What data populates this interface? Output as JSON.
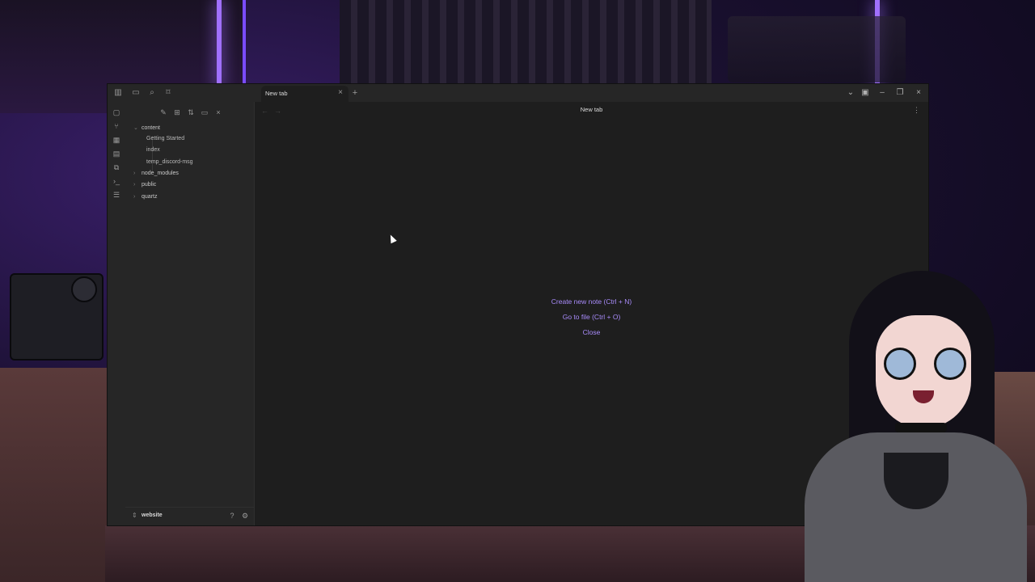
{
  "tab": {
    "label": "New tab",
    "close_icon": "close-icon",
    "new_tab_icon": "plus-icon"
  },
  "window_controls": [
    "chevron-down-icon",
    "layout-icon",
    "minimize-icon",
    "restore-icon",
    "close-icon"
  ],
  "ribbon_icons": [
    "file-icon",
    "graph-icon",
    "dashboard-icon",
    "calendar-icon",
    "copy-icon",
    "terminal-icon",
    "checklist-icon"
  ],
  "sidebar": {
    "toggles": [
      "sidebar-toggle-icon",
      "folder-icon",
      "search-icon",
      "bookmark-icon"
    ],
    "tools": [
      "new-note-icon",
      "new-folder-icon",
      "sort-icon",
      "collapse-icon",
      "close-icon"
    ],
    "tree": [
      {
        "label": "content",
        "expanded": true,
        "children": [
          "Getting Started",
          "index",
          "temp_discord-msg"
        ]
      },
      {
        "label": "node_modules",
        "expanded": false
      },
      {
        "label": "public",
        "expanded": false
      },
      {
        "label": "quartz",
        "expanded": false
      }
    ],
    "vault_name": "website"
  },
  "main": {
    "title": "New tab",
    "actions": [
      "Create new note (Ctrl + N)",
      "Go to file (Ctrl + O)",
      "Close"
    ]
  },
  "colors": {
    "accent": "#a88bfa",
    "bg": "#1e1e1e",
    "panel": "#262626"
  }
}
